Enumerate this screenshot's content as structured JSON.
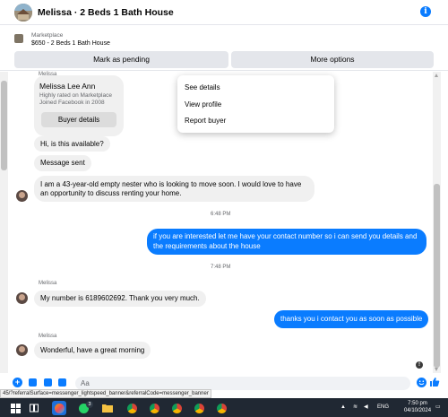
{
  "header": {
    "title": "Melissa · 2 Beds 1 Bath House",
    "thumbnail_icon": "listing-photo",
    "info_glyph": "i"
  },
  "listing": {
    "source": "Marketplace",
    "summary": "$650 - 2 Beds 1 Bath House",
    "mark_pending_label": "Mark as pending",
    "more_options_label": "More options"
  },
  "menu": {
    "items": [
      "See details",
      "View profile",
      "Report buyer"
    ]
  },
  "buyer_card": {
    "sender_name": "Melissa",
    "name": "Melissa Lee Ann",
    "line1": "Highly rated on Marketplace",
    "line2": "Joined Facebook in 2008",
    "button_label": "Buyer details"
  },
  "messages": [
    {
      "direction": "in",
      "text": "Hi, is this available?"
    },
    {
      "direction": "in",
      "text": "Message sent"
    },
    {
      "direction": "in",
      "text": "I am a 43-year-old empty nester who is looking to move soon. I would love to have an opportunity to discuss renting your home."
    },
    {
      "direction": "out",
      "text": "if you are interested let me have your contact number so i can send you details and the requirements about the house"
    },
    {
      "direction": "in",
      "text": "My number is 6189602692. Thank you very much."
    },
    {
      "direction": "out",
      "text": "thanks you i contact you as soon as possible"
    },
    {
      "direction": "in",
      "text": "Wonderful, have a great morning"
    }
  ],
  "timestamps": [
    "6:48 PM",
    "7:48 PM"
  ],
  "sender_labels": [
    "Melissa",
    "Melissa"
  ],
  "composer": {
    "placeholder": "Aa",
    "add_glyph": "+"
  },
  "status_url": "45/?referralSurface=messenger_lightspeed_banner&referralCode=messenger_banner",
  "taskbar": {
    "badge_count": "3",
    "language": "ENG",
    "time": "7:50 pm",
    "date": "04/10/2024",
    "icons": [
      "windows-icon",
      "search-icon",
      "task-view-icon",
      "whatsapp-icon",
      "file-explorer-icon",
      "chrome-icon",
      "chrome-icon",
      "chrome-icon",
      "chrome-icon",
      "chrome-icon"
    ]
  },
  "colors": {
    "accent": "#0a7cff",
    "bubble_in": "#f0f0f0",
    "button_bg": "#e4e6eb",
    "taskbar": "#202833"
  }
}
